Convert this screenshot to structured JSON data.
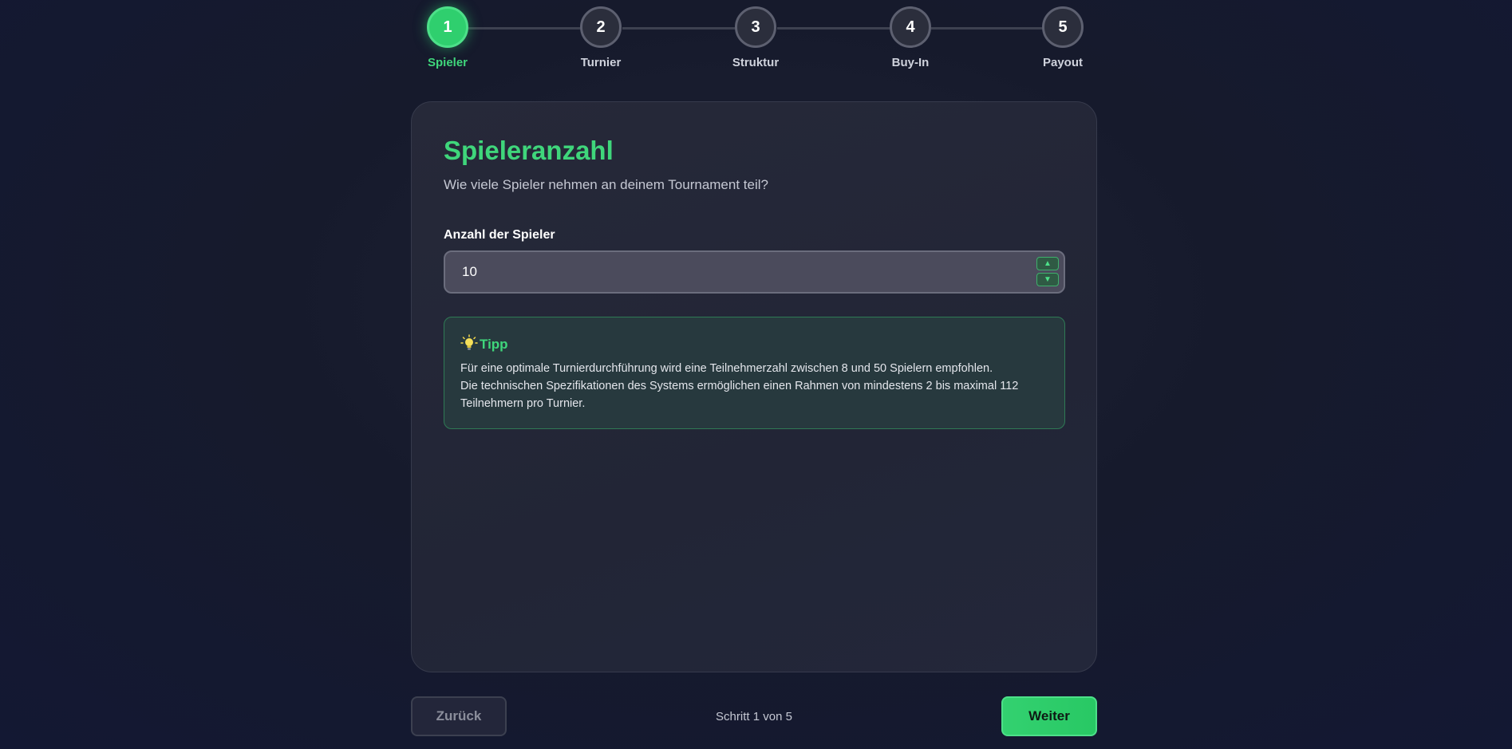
{
  "stepper": {
    "steps": [
      {
        "number": "1",
        "label": "Spieler",
        "active": true
      },
      {
        "number": "2",
        "label": "Turnier",
        "active": false
      },
      {
        "number": "3",
        "label": "Struktur",
        "active": false
      },
      {
        "number": "4",
        "label": "Buy-In",
        "active": false
      },
      {
        "number": "5",
        "label": "Payout",
        "active": false
      }
    ]
  },
  "card": {
    "title": "Spieleranzahl",
    "subtitle": "Wie viele Spieler nehmen an deinem Tournament teil?",
    "field_label": "Anzahl der Spieler",
    "player_count": "10",
    "spin_up": "▲",
    "spin_down": "▼"
  },
  "tip": {
    "icon": "lightbulb-icon",
    "title": "Tipp",
    "line1": "Für eine optimale Turnierdurchführung wird eine Teilnehmerzahl zwischen 8 und 50 Spielern empfohlen.",
    "line2": "Die technischen Spezifikationen des Systems ermöglichen einen Rahmen von mindestens 2 bis maximal 112 Teilnehmern pro Turnier."
  },
  "footer": {
    "back_label": "Zurück",
    "step_counter": "Schritt 1 von 5",
    "next_label": "Weiter"
  },
  "colors": {
    "accent": "#3fd67b",
    "background": "#161a2c",
    "card": "#242738"
  }
}
